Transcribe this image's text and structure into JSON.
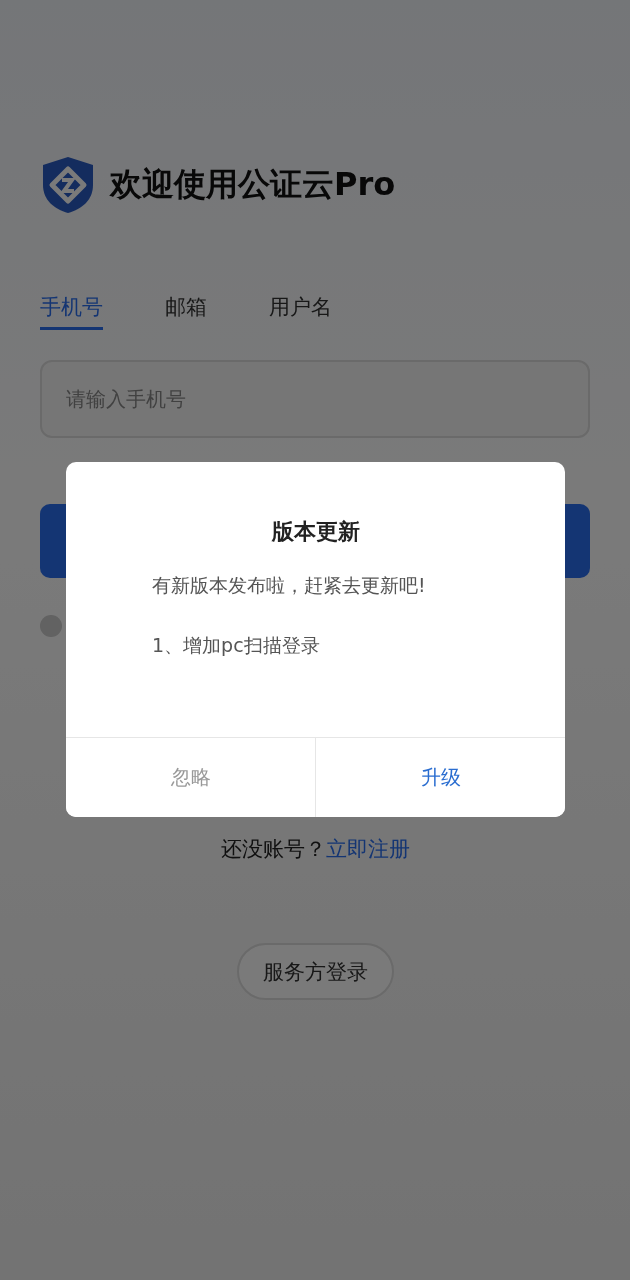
{
  "header": {
    "title": "欢迎使用公证云Pro"
  },
  "tabs": [
    {
      "label": "手机号",
      "selected": true
    },
    {
      "label": "邮箱",
      "selected": false
    },
    {
      "label": "用户名",
      "selected": false
    }
  ],
  "phone_field": {
    "placeholder": "请输入手机号"
  },
  "agreement": {
    "checked": false
  },
  "register": {
    "prompt": "还没账号？",
    "link": "立即注册"
  },
  "provider_login": "服务方登录",
  "dialog": {
    "title": "版本更新",
    "message": "有新版本发布啦，赶紧去更新吧!",
    "items": [
      "1、增加pc扫描登录"
    ],
    "buttons": [
      {
        "label": "忽略",
        "kind": "secondary"
      },
      {
        "label": "升级",
        "kind": "primary"
      }
    ]
  }
}
